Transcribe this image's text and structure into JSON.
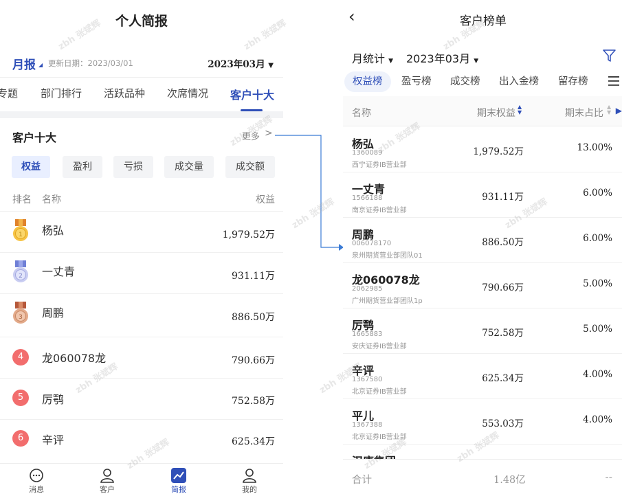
{
  "left": {
    "title": "个人简报",
    "period_tab": "月报",
    "update_date": "更新日期：2023/03/01",
    "month": "2023年03月",
    "tabs": [
      {
        "label": "专题"
      },
      {
        "label": "部门排行"
      },
      {
        "label": "活跃品种"
      },
      {
        "label": "次席情况"
      },
      {
        "label": "客户十大",
        "active": true
      }
    ],
    "card_title": "客户十大",
    "more_label": "更多",
    "chips": [
      {
        "label": "权益",
        "active": true
      },
      {
        "label": "盈利"
      },
      {
        "label": "亏损"
      },
      {
        "label": "成交量"
      },
      {
        "label": "成交额"
      }
    ],
    "list_header": {
      "rank": "排名",
      "name": "名称",
      "value": "权益"
    },
    "rows": [
      {
        "rank": "1",
        "medal": "gold-medal-icon",
        "name": "杨弘",
        "value": "1,979.52万"
      },
      {
        "rank": "2",
        "medal": "silver-medal-icon",
        "name": "一丈青",
        "value": "931.11万"
      },
      {
        "rank": "3",
        "medal": "bronze-medal-icon",
        "name": "周鹏",
        "value": "886.50万"
      },
      {
        "rank": "4",
        "name": "龙060078龙",
        "value": "790.66万"
      },
      {
        "rank": "5",
        "name": "厉鹗",
        "value": "752.58万"
      },
      {
        "rank": "6",
        "name": "辛评",
        "value": "625.34万"
      }
    ],
    "nav": [
      {
        "label": "消息",
        "icon": "message-icon"
      },
      {
        "label": "客户",
        "icon": "customer-icon"
      },
      {
        "label": "简报",
        "icon": "report-chart-icon",
        "active": true
      },
      {
        "label": "我的",
        "icon": "profile-icon"
      }
    ]
  },
  "right": {
    "title": "客户榜单",
    "stat_label": "月统计",
    "month": "2023年03月",
    "tabs": [
      {
        "label": "权益榜",
        "active": true
      },
      {
        "label": "盈亏榜"
      },
      {
        "label": "成交榜"
      },
      {
        "label": "出入金榜"
      },
      {
        "label": "留存榜"
      }
    ],
    "table_header": {
      "name": "名称",
      "equity": "期末权益",
      "ratio": "期末占比"
    },
    "rows": [
      {
        "name": "杨弘",
        "id": "1360089",
        "dept": "西宁证券IB营业部",
        "equity": "1,979.52万",
        "ratio": "13.00%"
      },
      {
        "name": "一丈青",
        "id": "1566188",
        "dept": "南京证券IB营业部",
        "equity": "931.11万",
        "ratio": "6.00%"
      },
      {
        "name": "周鹏",
        "id": "006078170",
        "dept": "泉州期货营业部团队01",
        "equity": "886.50万",
        "ratio": "6.00%"
      },
      {
        "name": "龙060078龙",
        "id": "2062985",
        "dept": "广州期货营业部团队1p",
        "equity": "790.66万",
        "ratio": "5.00%"
      },
      {
        "name": "厉鹗",
        "id": "1665883",
        "dept": "安庆证券IB营业部",
        "equity": "752.58万",
        "ratio": "5.00%"
      },
      {
        "name": "辛评",
        "id": "1367580",
        "dept": "北京证券IB营业部",
        "equity": "625.34万",
        "ratio": "4.00%"
      },
      {
        "name": "平儿",
        "id": "1367388",
        "dept": "北京证券IB营业部",
        "equity": "553.03万",
        "ratio": "4.00%"
      },
      {
        "name": "汉唐集团",
        "id": "",
        "dept": "",
        "equity": "",
        "ratio": ""
      }
    ],
    "footer": {
      "label": "合计",
      "total": "1.48亿",
      "ratio": "--"
    }
  },
  "watermark": "zbh 张斌辉",
  "colors": {
    "accent": "#2f4fb8",
    "connector": "#3a7bd5",
    "badge_red": "#f26d6d"
  }
}
